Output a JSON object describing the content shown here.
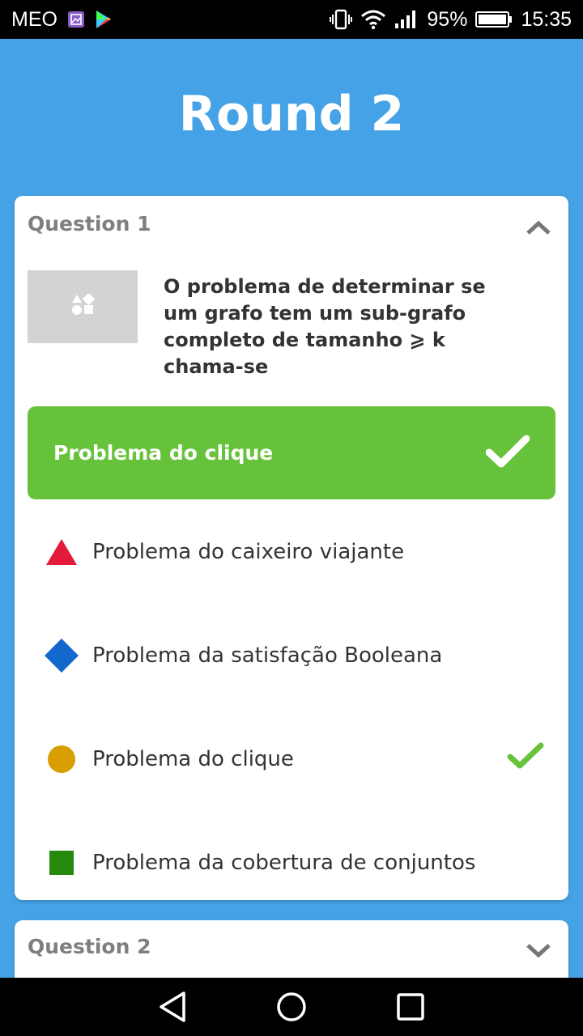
{
  "status_bar": {
    "carrier": "MEO",
    "battery": "95%",
    "time": "15:35"
  },
  "header": {
    "title": "Round 2"
  },
  "questions": [
    {
      "label": "Question 1",
      "expanded": true,
      "image_icon": "shapes-icon",
      "text": "O problema de determinar se um grafo tem um sub-grafo completo de tamanho ⩾ k chama-se",
      "correct_answer": "Problema do clique",
      "options": [
        {
          "label": "Problema do caixeiro viajante",
          "shape": "triangle",
          "color": "#e21b3c",
          "correct": false
        },
        {
          "label": "Problema da satisfação Booleana",
          "shape": "diamond",
          "color": "#1368ce",
          "correct": false
        },
        {
          "label": "Problema do clique",
          "shape": "circle",
          "color": "#d89e00",
          "correct": true
        },
        {
          "label": "Problema da cobertura de conjuntos",
          "shape": "square",
          "color": "#26890c",
          "correct": false
        }
      ]
    },
    {
      "label": "Question 2",
      "expanded": false
    }
  ],
  "colors": {
    "background": "#46a2e6",
    "correct_green": "#66c23a",
    "check_green": "#66c23a"
  }
}
